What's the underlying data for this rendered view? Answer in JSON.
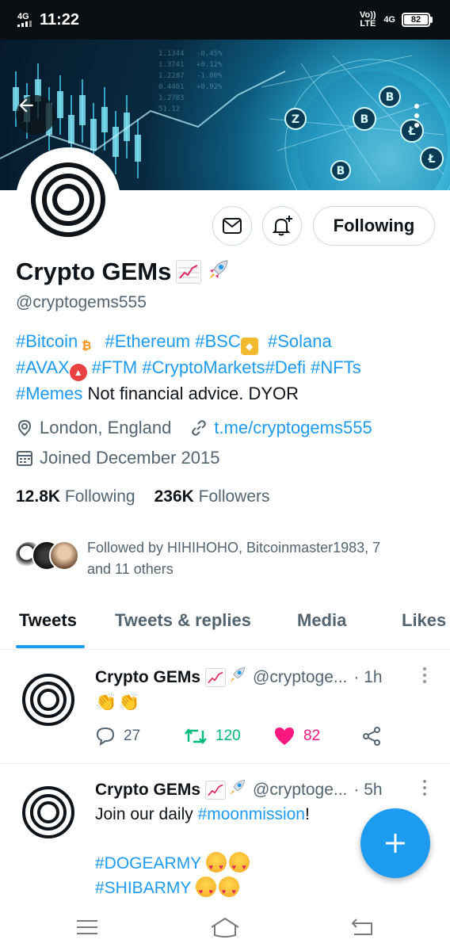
{
  "status_bar": {
    "time": "11:22",
    "signal_left": "4G",
    "volte": "Vo)) LTE",
    "network_right": "4G",
    "battery": "82"
  },
  "profile": {
    "display_name": "Crypto GEMs",
    "handle": "@cryptogems555",
    "follow_button": "Following",
    "bio": {
      "line1": [
        "#Bitcoin",
        "#Ethereum",
        "#BSC",
        "#Solana"
      ],
      "line2": [
        "#AVAX",
        "#FTM",
        "#CryptoMarkets",
        "#Defi",
        "#NFTs"
      ],
      "line3_tag": "#Memes",
      "line3_text": "Not financial advice. DYOR"
    },
    "location": "London, England",
    "website": "t.me/cryptogems555",
    "joined": "Joined December 2015",
    "following_count": "12.8K",
    "following_label": "Following",
    "followers_count": "236K",
    "followers_label": "Followers",
    "followed_by_line1": "Followed by HIHIHOHO, Bitcoinmaster1983, 7",
    "followed_by_line2": "and 11 others"
  },
  "tabs": [
    "Tweets",
    "Tweets & replies",
    "Media",
    "Likes"
  ],
  "active_tab": "Tweets",
  "tweets": [
    {
      "name": "Crypto GEMs",
      "handle": "@cryptoge...",
      "time": "· 1h",
      "replies": "27",
      "retweets": "120",
      "likes": "82"
    },
    {
      "name": "Crypto GEMs",
      "handle": "@cryptoge...",
      "time": "· 5h",
      "text_line1_pre": "Join our daily ",
      "text_line1_tag": "#moonmission",
      "text_line1_post": "!",
      "tag2": "#DOGEARMY",
      "tag3": "#SHIBARMY"
    }
  ],
  "colors": {
    "accent": "#1d9bf0",
    "retweet": "#00ba7c",
    "like": "#f91880",
    "text_secondary": "#536471"
  },
  "icons": [
    "back-arrow-icon",
    "more-vertical-icon",
    "mail-icon",
    "bell-plus-icon",
    "location-icon",
    "link-icon",
    "calendar-icon",
    "reply-icon",
    "retweet-icon",
    "heart-icon",
    "share-icon",
    "plus-icon",
    "menu-icon",
    "home-icon",
    "back-nav-icon"
  ]
}
